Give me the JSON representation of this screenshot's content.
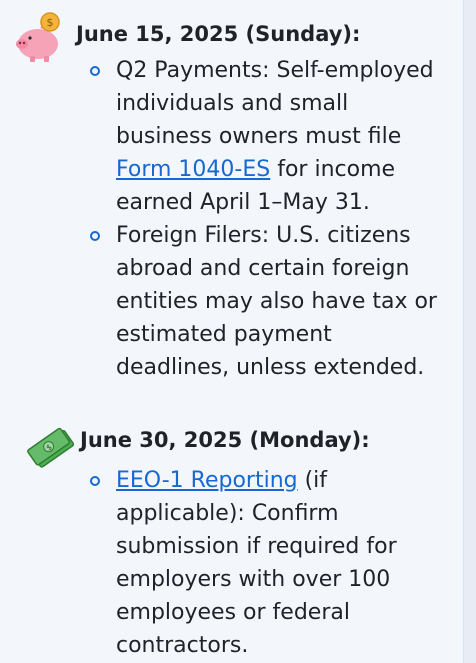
{
  "sections": [
    {
      "icon": "piggy-bank-coin-icon",
      "date_label": "June 15, 2025 (Sunday):",
      "items": [
        {
          "before": "Q2 Payments: Self-employed individuals and small business owners must file ",
          "link": "Form 1040-ES",
          "after": " for income earned April 1–May 31."
        },
        {
          "text": "Foreign Filers: U.S. citizens abroad and certain foreign entities may also have tax or estimated payment deadlines, unless extended."
        }
      ]
    },
    {
      "icon": "money-stack-icon",
      "date_label": "June 30, 2025 (Monday):",
      "items": [
        {
          "link": "EEO-1 Reporting",
          "after": " (if applicable): Confirm submission if required for employers with over 100 employees or federal contractors."
        }
      ]
    }
  ],
  "colors": {
    "link": "#1769d1",
    "bullet": "#1769d1",
    "text": "#1f2328"
  }
}
